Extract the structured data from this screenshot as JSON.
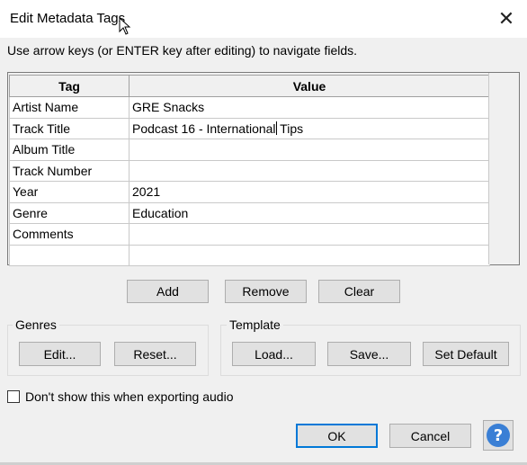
{
  "window": {
    "title": "Edit Metadata Tags",
    "close_symbol": "✕"
  },
  "instructions": "Use arrow keys (or ENTER key after editing) to navigate fields.",
  "table": {
    "headers": [
      "Tag",
      "Value"
    ],
    "rows": [
      {
        "tag": "Artist Name",
        "value": "GRE Snacks"
      },
      {
        "tag": "Track Title",
        "value": "Podcast 16 - International Tips",
        "value_before_caret": "Podcast 16 - International",
        "value_after_caret": " Tips"
      },
      {
        "tag": "Album Title",
        "value": ""
      },
      {
        "tag": "Track Number",
        "value": ""
      },
      {
        "tag": "Year",
        "value": "2021"
      },
      {
        "tag": "Genre",
        "value": "Education"
      },
      {
        "tag": "Comments",
        "value": ""
      },
      {
        "tag": "",
        "value": ""
      }
    ]
  },
  "row_buttons": {
    "add": "Add",
    "remove": "Remove",
    "clear": "Clear"
  },
  "genres": {
    "label": "Genres",
    "edit": "Edit...",
    "reset": "Reset..."
  },
  "template": {
    "label": "Template",
    "load": "Load...",
    "save": "Save...",
    "set_default": "Set Default"
  },
  "dont_show": {
    "label": "Don't show this when exporting audio",
    "checked": false
  },
  "dialog_buttons": {
    "ok": "OK",
    "cancel": "Cancel",
    "help_symbol": "?"
  },
  "colors": {
    "accent": "#0078d7",
    "help": "#3a7fd5"
  }
}
